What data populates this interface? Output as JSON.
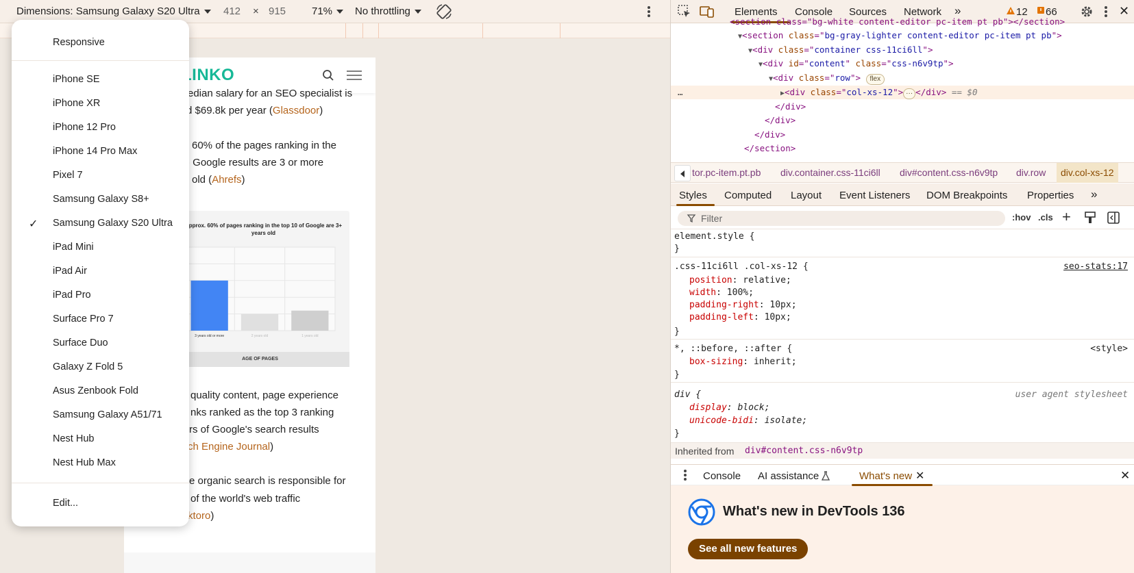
{
  "device_toolbar": {
    "dimensions_label": "Dimensions: Samsung Galaxy S20 Ultra",
    "width": "412",
    "times": "×",
    "height": "915",
    "zoom": "71%",
    "throttling": "No throttling"
  },
  "device_menu": {
    "responsive": "Responsive",
    "devices": [
      "iPhone SE",
      "iPhone XR",
      "iPhone 12 Pro",
      "iPhone 14 Pro Max",
      "Pixel 7",
      "Samsung Galaxy S8+",
      "Samsung Galaxy S20 Ultra",
      "iPad Mini",
      "iPad Air",
      "iPad Pro",
      "Surface Pro 7",
      "Surface Duo",
      "Galaxy Z Fold 5",
      "Asus Zenbook Fold",
      "Samsung Galaxy A51/71",
      "Nest Hub",
      "Nest Hub Max"
    ],
    "selected": "Samsung Galaxy S20 Ultra",
    "edit": "Edit..."
  },
  "page": {
    "logo": "LINKO",
    "lines": {
      "l1": "edian salary for an SEO specialist is",
      "l2a": "d $69.8k per year (",
      "l2_link": "Glassdoor",
      "l2b": ")",
      "l3": "60% of the pages ranking in the",
      "l4": ") Google results are 3 or more",
      "l5a": "old (",
      "l5_link": "Ahrefs",
      "l5b": ")",
      "l6": "quality content, page experience",
      "l7": "nks ranked as the top 3 ranking",
      "l8": "rs of Google's search results",
      "l9_link": "ch Engine Journal",
      "l9b": ")",
      "l10": "e organic search is responsible for",
      "l11": "of the world's web traffic",
      "l12_link": "ktoro",
      "l12b": ")"
    }
  },
  "chart_data": {
    "type": "bar",
    "title": "Approx. 60% of pages ranking in the top 10 of Google are 3+ years old",
    "categories": [
      "3 years old or more",
      "2 years old",
      "1 years old"
    ],
    "values": [
      60,
      20,
      24
    ],
    "xlabel": "AGE OF PAGES",
    "ylim": [
      0,
      100
    ],
    "colors": [
      "#4285f4",
      "#e0e0e0",
      "#cfcfcf"
    ],
    "grid": true
  },
  "devtools": {
    "tabs": [
      "Elements",
      "Console",
      "Sources",
      "Network"
    ],
    "active_tab": "Elements",
    "warnings": "12",
    "issues": "66",
    "dom": {
      "l0": "<section class=\"bg-white content-editor pc-item pt pb\"></section>",
      "l1_tag": "section",
      "l1_class": "bg-gray-lighter content-editor pc-item pt pb",
      "l2_tag": "div",
      "l2_class": "container css-11ci6ll",
      "l3_id": "content",
      "l3_class": "css-n6v9tp",
      "l4_class": "row",
      "l4_pill": "flex",
      "l5_class": "col-xs-12",
      "l5_suffix": "== $0",
      "close_div": "</div>",
      "close_section": "</section>",
      "ellipsis": "…",
      "dots": "···"
    },
    "breadcrumbs": [
      "tor.pc-item.pt.pb",
      "div.container.css-11ci6ll",
      "div#content.css-n6v9tp",
      "div.row",
      "div.col-xs-12"
    ],
    "style_tabs": [
      "Styles",
      "Computed",
      "Layout",
      "Event Listeners",
      "DOM Breakpoints",
      "Properties"
    ],
    "active_style_tab": "Styles",
    "filter_placeholder": "Filter",
    "hov": ":hov",
    "cls": ".cls",
    "rules": {
      "element_style": "element.style {",
      "close": "}",
      "r1_selector": ".css-11ci6ll .col-xs-12 {",
      "r1_source": "seo-stats:17",
      "r1_props": [
        {
          "p": "position",
          "v": "relative;"
        },
        {
          "p": "width",
          "v": "100%;"
        },
        {
          "p": "padding-right",
          "v": "10px;"
        },
        {
          "p": "padding-left",
          "v": "10px;"
        }
      ],
      "r2_selector": "*, ::before, ::after {",
      "r2_source": "<style>",
      "r2_prop": "box-sizing",
      "r2_val": "inherit;",
      "r3_selector": "div {",
      "r3_source": "user agent stylesheet",
      "r3_p1": "display",
      "r3_v1": "block;",
      "r3_p2": "unicode-bidi",
      "r3_v2": "isolate;",
      "inherited_label": "Inherited from",
      "inherited_target": "div#content.css-n6v9tp"
    },
    "drawer": {
      "tabs": [
        "Console",
        "AI assistance",
        "What's new"
      ],
      "active": "What's new",
      "heading": "What's new in DevTools 136",
      "button": "See all new features"
    }
  }
}
